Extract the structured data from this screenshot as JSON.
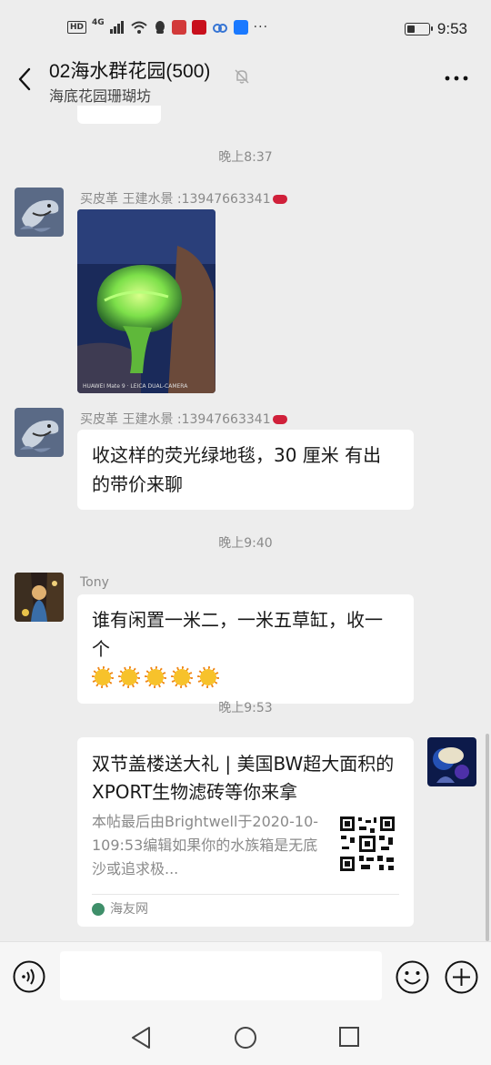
{
  "status_bar": {
    "network_hd": "HD",
    "network_gen": "4G",
    "battery_level": 0.35,
    "time": "9:53"
  },
  "header": {
    "title": "02海水群花园(500)",
    "subtitle": "海底花园珊瑚坊",
    "back_icon": "chevron-left-icon",
    "mute_icon": "bell-off-icon",
    "more_icon": "more-horizontal-icon"
  },
  "messages": [
    {
      "type": "timestamp",
      "text": "晚上8:37"
    },
    {
      "type": "image",
      "sender": "买皮革 王建水景 :13947663341",
      "sender_emoji": "kiss-mark-icon",
      "photo_caption": "HUAWEI Mate 9 · LEICA DUAL-CAMERA"
    },
    {
      "type": "text",
      "sender": "买皮革 王建水景 :13947663341",
      "sender_emoji": "kiss-mark-icon",
      "text": "收这样的荧光绿地毯，30 厘米  有出的带价来聊"
    },
    {
      "type": "timestamp",
      "text": "晚上9:40"
    },
    {
      "type": "text",
      "sender": "Tony",
      "text": "谁有闲置一米二，一米五草缸，收一个",
      "emoji": "sun-emoji",
      "emoji_count": 5
    },
    {
      "type": "timestamp",
      "text": "晚上9:53"
    },
    {
      "type": "link",
      "title": "双节盖楼送大礼 | 美国BW超大面积的XPORT生物滤砖等你来拿",
      "description": "本帖最后由Brightwell于2020-10-109:53编辑如果你的水族箱是无底沙或追求极...",
      "source": "海友网",
      "thumbnail": "qr-code-icon"
    }
  ],
  "input_bar": {
    "voice_icon": "voice-icon",
    "text_value": "",
    "emoji_icon": "smiley-icon",
    "plus_icon": "plus-circle-icon"
  },
  "nav_bar": {
    "back_icon": "triangle-back-icon",
    "home_icon": "circle-home-icon",
    "recent_icon": "square-recents-icon"
  },
  "colors": {
    "background": "#ededed",
    "bubble": "#ffffff",
    "meta_text": "#8a8a8a"
  }
}
